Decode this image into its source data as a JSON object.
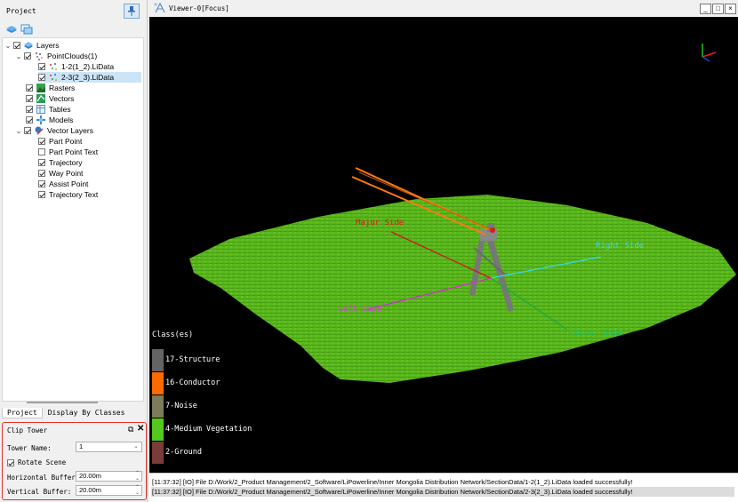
{
  "project_panel": {
    "title": "Project",
    "tree": [
      {
        "label": "Layers",
        "checked": true,
        "expanded": true,
        "icon": "layers-icon"
      },
      {
        "label": "PointClouds(1)",
        "checked": true,
        "expanded": true,
        "icon": "point-cloud-icon"
      },
      {
        "label": "1-2(1_2).LiData",
        "checked": true,
        "icon": "point-cloud-file-icon"
      },
      {
        "label": "2-3(2_3).LiData",
        "checked": true,
        "icon": "point-cloud-file-icon",
        "selected": true
      },
      {
        "label": "Rasters",
        "checked": true,
        "icon": "raster-icon"
      },
      {
        "label": "Vectors",
        "checked": true,
        "icon": "vector-icon"
      },
      {
        "label": "Tables",
        "checked": true,
        "icon": "table-icon"
      },
      {
        "label": "Models",
        "checked": true,
        "icon": "model-icon"
      },
      {
        "label": "Vector Layers",
        "checked": true,
        "expanded": true,
        "icon": "vector-layers-icon"
      },
      {
        "label": "Part Point",
        "checked": true
      },
      {
        "label": "Part Point Text",
        "checked": false
      },
      {
        "label": "Trajectory",
        "checked": true
      },
      {
        "label": "Way Point",
        "checked": true
      },
      {
        "label": "Assist Point",
        "checked": true
      },
      {
        "label": "Trajectory Text",
        "checked": true
      }
    ],
    "tabs": [
      "Project",
      "Display By Classes"
    ]
  },
  "clip_tower": {
    "title": "Clip Tower",
    "tower_name_label": "Tower Name:",
    "tower_name_value": "1",
    "rotate_scene_label": "Rotate Scene",
    "rotate_scene_checked": true,
    "horizontal_buffer_label": "Horizontal Buffer:",
    "horizontal_buffer_value": "20.00m",
    "vertical_buffer_label": "Vertical Buffer:",
    "vertical_buffer_value": "20.00m"
  },
  "viewer": {
    "title": "Viewer-0[Focus]",
    "window_buttons": [
      "_",
      "□",
      "×"
    ],
    "labels": {
      "major_side": "Major Side",
      "right_side": "Right Side",
      "left_side": "Left Side",
      "minor_side": "Minor Side"
    },
    "legend": {
      "title": "Class(es)",
      "items": [
        {
          "label": "17-Structure",
          "color": "#646464"
        },
        {
          "label": "16-Conductor",
          "color": "#ff6a00"
        },
        {
          "label": "7-Noise",
          "color": "#7c7c5c"
        },
        {
          "label": "4-Medium Vegetation",
          "color": "#55c81e"
        },
        {
          "label": "2-Ground",
          "color": "#7a3b3b"
        }
      ]
    }
  },
  "log": [
    "[11:37:32] [IO]    File D:/Work/2_Product Management/2_Software/LiPowerline/Inner Mongolia Distribution Network/SectionData/1-2(1_2).LiData loaded successfully!",
    "[11:37:32] [IO]    File D:/Work/2_Product Management/2_Software/LiPowerline/Inner Mongolia Distribution Network/SectionData/2-3(2_3).LiData loaded successfully!"
  ]
}
